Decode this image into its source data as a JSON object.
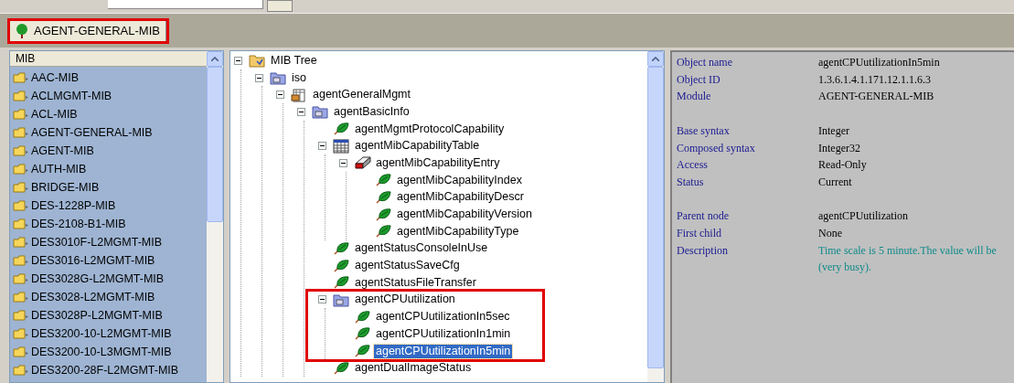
{
  "tabs": [
    {
      "label": "AGENT-GENERAL-MIB",
      "selected": true,
      "highlighted": true
    }
  ],
  "mib_list": {
    "header": "MIB",
    "items": [
      {
        "label": "AAC-MIB"
      },
      {
        "label": "ACLMGMT-MIB"
      },
      {
        "label": "ACL-MIB"
      },
      {
        "label": "AGENT-GENERAL-MIB"
      },
      {
        "label": "AGENT-MIB"
      },
      {
        "label": "AUTH-MIB"
      },
      {
        "label": "BRIDGE-MIB"
      },
      {
        "label": "DES-1228P-MIB"
      },
      {
        "label": "DES-2108-B1-MIB"
      },
      {
        "label": "DES3010F-L2MGMT-MIB"
      },
      {
        "label": "DES3016-L2MGMT-MIB"
      },
      {
        "label": "DES3028G-L2MGMT-MIB"
      },
      {
        "label": "DES3028-L2MGMT-MIB"
      },
      {
        "label": "DES3028P-L2MGMT-MIB"
      },
      {
        "label": "DES3200-10-L2MGMT-MIB"
      },
      {
        "label": "DES3200-10-L3MGMT-MIB"
      },
      {
        "label": "DES3200-28F-L2MGMT-MIB"
      }
    ]
  },
  "mib_tree": [
    {
      "label": "MIB Tree",
      "kind": "root",
      "expanded": true,
      "selected": false,
      "highlighted": false,
      "children": [
        {
          "label": "iso",
          "kind": "group",
          "expanded": true,
          "selected": false,
          "highlighted": false,
          "children": [
            {
              "label": "agentGeneralMgmt",
              "kind": "module",
              "expanded": true,
              "selected": false,
              "highlighted": false,
              "children": [
                {
                  "label": "agentBasicInfo",
                  "kind": "group",
                  "expanded": true,
                  "selected": false,
                  "highlighted": false,
                  "children": [
                    {
                      "label": "agentMgmtProtocolCapability",
                      "kind": "leaf",
                      "selected": false,
                      "highlighted": false
                    },
                    {
                      "label": "agentMibCapabilityTable",
                      "kind": "table",
                      "expanded": true,
                      "selected": false,
                      "highlighted": false,
                      "children": [
                        {
                          "label": "agentMibCapabilityEntry",
                          "kind": "entry",
                          "expanded": true,
                          "selected": false,
                          "highlighted": false,
                          "children": [
                            {
                              "label": "agentMibCapabilityIndex",
                              "kind": "leaf",
                              "selected": false,
                              "highlighted": false
                            },
                            {
                              "label": "agentMibCapabilityDescr",
                              "kind": "leaf",
                              "selected": false,
                              "highlighted": false
                            },
                            {
                              "label": "agentMibCapabilityVersion",
                              "kind": "leaf",
                              "selected": false,
                              "highlighted": false
                            },
                            {
                              "label": "agentMibCapabilityType",
                              "kind": "leaf",
                              "selected": false,
                              "highlighted": false
                            }
                          ]
                        }
                      ]
                    },
                    {
                      "label": "agentStatusConsoleInUse",
                      "kind": "leaf",
                      "selected": false,
                      "highlighted": false
                    },
                    {
                      "label": "agentStatusSaveCfg",
                      "kind": "leaf",
                      "selected": false,
                      "highlighted": false
                    },
                    {
                      "label": "agentStatusFileTransfer",
                      "kind": "leaf",
                      "selected": false,
                      "highlighted": false
                    },
                    {
                      "label": "agentCPUutilization",
                      "kind": "group",
                      "expanded": true,
                      "selected": false,
                      "highlighted": true,
                      "children": [
                        {
                          "label": "agentCPUutilizationIn5sec",
                          "kind": "leaf",
                          "selected": false,
                          "highlighted": false
                        },
                        {
                          "label": "agentCPUutilizationIn1min",
                          "kind": "leaf",
                          "selected": false,
                          "highlighted": false
                        },
                        {
                          "label": "agentCPUutilizationIn5min",
                          "kind": "leaf",
                          "selected": true,
                          "highlighted": false
                        }
                      ]
                    },
                    {
                      "label": "agentDualImageStatus",
                      "kind": "leaf",
                      "selected": false,
                      "highlighted": false
                    }
                  ]
                }
              ]
            }
          ]
        }
      ]
    }
  ],
  "details": [
    [
      {
        "label": "Object name",
        "value": [
          "agentCPUutilizationIn5min"
        ]
      },
      {
        "label": "Object ID",
        "value": [
          "1.3.6.1.4.1.171.12.1.1.6.3"
        ]
      },
      {
        "label": "Module",
        "value": [
          "AGENT-GENERAL-MIB"
        ]
      }
    ],
    [
      {
        "label": "Base syntax",
        "value": [
          "Integer"
        ]
      },
      {
        "label": "Composed syntax",
        "value": [
          "Integer32"
        ]
      },
      {
        "label": "Access",
        "value": [
          "Read-Only"
        ]
      },
      {
        "label": "Status",
        "value": [
          "Current"
        ]
      }
    ],
    [
      {
        "label": "Parent node",
        "value": [
          "agentCPUutilization"
        ]
      },
      {
        "label": "First child",
        "value": [
          "None"
        ]
      },
      {
        "label": "Description",
        "kind": "description",
        "value": [
          "Time scale is 5 minute.The value will be",
          "(very busy)."
        ]
      }
    ]
  ]
}
